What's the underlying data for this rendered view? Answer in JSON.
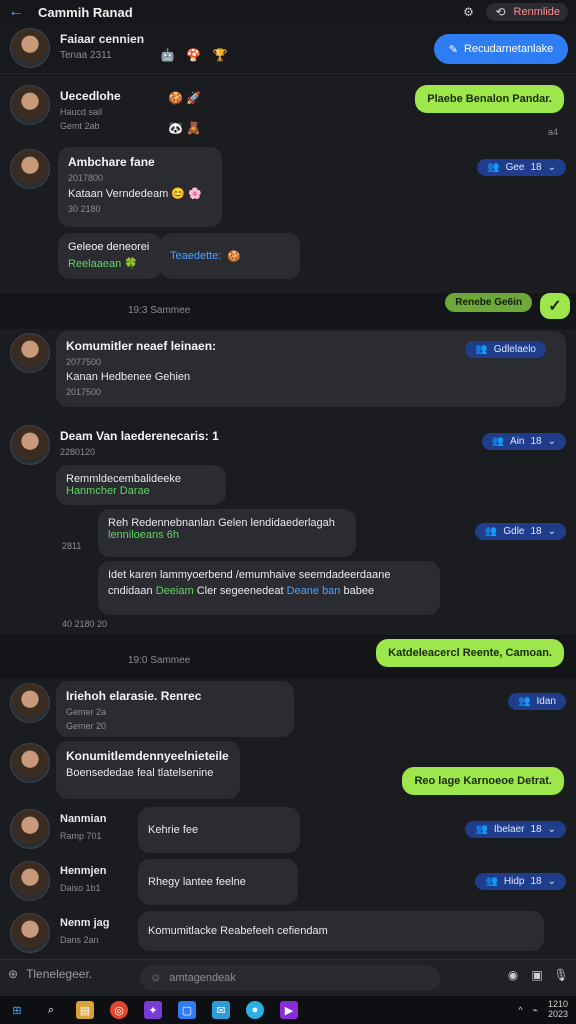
{
  "window": {
    "title": "Cammih Ranad",
    "back_icon": "arrow-left-icon",
    "top_pill_label": "Renmlide"
  },
  "header": {
    "name": "Faiaar cennien",
    "sub": "Tenaa 2311",
    "emojis": "🤖 🍄 🏆",
    "cta_label": "Recudarnetanlake"
  },
  "messages": [
    {
      "id": "m1",
      "title": "Uecedlohe",
      "meta": "Haucd sail",
      "meta2": "Gemt 2ab",
      "emojis": "🍪 🚀",
      "emojis2": "🐼 🧸"
    },
    {
      "id": "m2",
      "title": "Ambchare fane",
      "meta": "2017800",
      "text": "Kataan Verndedeam 😊 🌸",
      "meta2": "30 2180"
    },
    {
      "id": "m3",
      "title": "Geleoe deneorei",
      "text": "Reelaaean 🍀",
      "side_text": "Teaedette:"
    },
    {
      "id": "m4",
      "title": "Komumitler neaef leinaen:",
      "meta": "2077500",
      "text": "Kanan Hedbenee Gehien",
      "meta2": "2017500"
    },
    {
      "id": "m5",
      "title": "Deam Van laederenecaris: 1",
      "meta": "2280120",
      "text": "Remmldecembalideeke",
      "text2": "Hanmcher Darae"
    },
    {
      "id": "m6",
      "title": "Reh Redennebnanlan Gelen lendidaederlagah",
      "text": "lenniloeans 6h"
    },
    {
      "id": "m7",
      "title": "Idet karen lammyoerbend /emumhaive seemdadeerdaane",
      "text": "cndidaan",
      "green": "Deeiam",
      "text2": "Cler segeenedeat",
      "blue": "Deane ban",
      "tail": "babee"
    },
    {
      "id": "m8",
      "title": "Iriehoh elarasie. Renrec",
      "meta": "Gemer 2a",
      "meta2": "Gemer 20"
    },
    {
      "id": "m9",
      "title": "Konumitlemdennyeelnieteile",
      "text": "Boensededae feal tlatelsenine"
    },
    {
      "id": "m10",
      "name": "Nanmian",
      "sub": "Ramp 701",
      "text": "Kehrie fee"
    },
    {
      "id": "m11",
      "name": "Henmjen",
      "sub": "Daiso 1b1",
      "text": "Rhegy lantee feelne"
    },
    {
      "id": "m12",
      "name": "Nenm jag",
      "sub": "Dans 2an",
      "text": "Komumitlacke Reabefeeh cefiendam"
    }
  ],
  "outgoing": [
    {
      "id": "o1",
      "text": "Plaebe Benalon Pandar.",
      "time": "a4"
    },
    {
      "id": "o2",
      "text": "Renebe Ge6in"
    },
    {
      "id": "o3",
      "text": "Katdeleacercl Reente, Camoan."
    },
    {
      "id": "o4",
      "text": "Reo lage Karnoeoe Detrat."
    }
  ],
  "badges": [
    {
      "id": "b1",
      "label": "Gee",
      "count": "18"
    },
    {
      "id": "b2",
      "label": "Gdlelaelo"
    },
    {
      "id": "b3",
      "label": "Ain",
      "count": "18"
    },
    {
      "id": "b4",
      "label": "Gdle",
      "count": "18"
    },
    {
      "id": "b5",
      "label": "Idan"
    },
    {
      "id": "b6",
      "label": "Ibelaer",
      "count": "18"
    },
    {
      "id": "b7",
      "label": "Hidp",
      "count": "18"
    }
  ],
  "dividers": [
    {
      "label": "19:3 Sammee"
    },
    {
      "label": "19:0 Sammee"
    }
  ],
  "stamps": {
    "s1": "2017 7500",
    "s2": "2811",
    "s3": "40 2180 20"
  },
  "composer": {
    "left_label": "Tlenelegeer.",
    "placeholder": "amtagendeak"
  },
  "taskbar": {
    "time": "1210",
    "date": "2023"
  },
  "colors": {
    "accent": "#2f7df2",
    "outgoing": "#9de64b",
    "badge": "#1f3d8a",
    "bg": "#1b1c20"
  }
}
